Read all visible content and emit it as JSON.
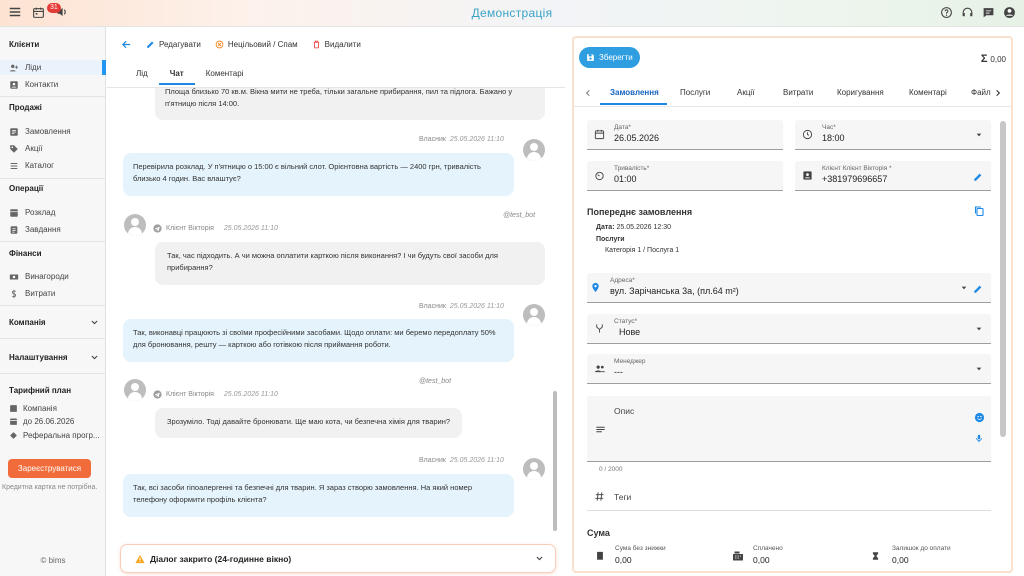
{
  "header": {
    "brand": "Демонстрація",
    "calendar_badge": "31"
  },
  "sidebar": {
    "sections": {
      "clients": "Клієнти",
      "sales": "Продажі",
      "operations": "Операції",
      "finance": "Фінанси",
      "company": "Компанія",
      "settings": "Налаштування",
      "tariff": "Тарифний план"
    },
    "items": {
      "leads": "Ліди",
      "contacts": "Контакти",
      "orders": "Замовлення",
      "promos": "Акції",
      "catalog": "Каталог",
      "schedule": "Розклад",
      "tasks": "Завдання",
      "rewards": "Винагороди",
      "expenses": "Витрати"
    },
    "tariff": {
      "company": "Компанія",
      "until": "до 26.06.2026",
      "referral": "Реферальна прогр..."
    },
    "register_label": "Зареєструватися",
    "card_note": "Кредитна картка не потрібна.",
    "copyright": "© bims"
  },
  "lead_panel": {
    "actions": {
      "edit": "Редагувати",
      "spam": "Нецільовий / Спам",
      "delete": "Видалити"
    },
    "tabs": [
      "Лід",
      "Чат",
      "Коментарі"
    ],
    "messages": [
      {
        "text": "Площа близько 70 кв.м. Вікна мити не треба, тільки загальне прибирання, пил та підлога. Бажано у п'ятницю після 14:00."
      },
      {
        "sender": "Власник",
        "time": "25.05.2026 11:10",
        "text": "Перевірила розклад. У п'ятницю о 15:00 є вільний слот. Орієнтовна вартість — 2400 грн, тривалість близько 4 годин. Вас влаштує?"
      },
      {
        "sender": "Клієнт Вікторія",
        "time": "25.05.2026 11:10",
        "bot": "@test_bot",
        "text": "Так, час підходить. А чи можна оплатити карткою після виконання? І чи будуть свої засоби для прибирання?"
      },
      {
        "sender": "Власник",
        "time": "25.05.2026 11:10",
        "text": "Так, виконавці працюють зі своїми професійними засобами. Щодо оплати: ми беремо передоплату 50% для бронювання, решту — карткою або готівкою після приймання роботи."
      },
      {
        "sender": "Клієнт Вікторія",
        "time": "25.05.2026 11:10",
        "bot": "@test_bot",
        "text": "Зрозуміло. Тоді давайте бронювати. Ще маю кота, чи безпечна хімія для тварин?"
      },
      {
        "sender": "Власник",
        "time": "25.05.2026 11:10",
        "text": "Так, всі засоби гіпоалергенні та безпечні для тварин. Я зараз створю замовлення. На який номер телефону оформити профіль клієнта?"
      }
    ],
    "dialog_closed": "Діалог закрито (24-годинне вікно)"
  },
  "order_panel": {
    "save_label": "Зберегти",
    "total": "0,00",
    "tabs": [
      "Замовлення",
      "Послуги",
      "Акції",
      "Витрати",
      "Коригування",
      "Коментарі",
      "Файли"
    ],
    "date": {
      "label": "Дата*",
      "value": "26.05.2026"
    },
    "time": {
      "label": "Час*",
      "value": "18:00"
    },
    "duration": {
      "label": "Тривалість*",
      "value": "01:00"
    },
    "client": {
      "label": "Клієнт  Клієнт Вікторія *",
      "value": "+381979696657"
    },
    "prev": {
      "title": "Попереднє замовлення",
      "date_label": "Дата:",
      "date_value": "25.05.2026 12:30",
      "services_label": "Послуги",
      "services_value": "Категорія 1 / Послуга 1"
    },
    "address": {
      "label": "Адреса*",
      "value": "вул. Зарічанська 3а, (пл.64 m²)"
    },
    "status": {
      "label": "Статус*",
      "value": "Нове"
    },
    "manager": {
      "label": "Менеджер",
      "value": "---"
    },
    "description": {
      "label": "Опис",
      "counter": "0 / 2000"
    },
    "tags": {
      "label": "Теги"
    },
    "sum": {
      "title": "Сума",
      "no_discount_label": "Сума без знижки",
      "no_discount_value": "0,00",
      "paid_label": "Сплачено",
      "paid_value": "0,00",
      "remaining_label": "Залишок до оплати",
      "remaining_value": "0,00"
    }
  }
}
